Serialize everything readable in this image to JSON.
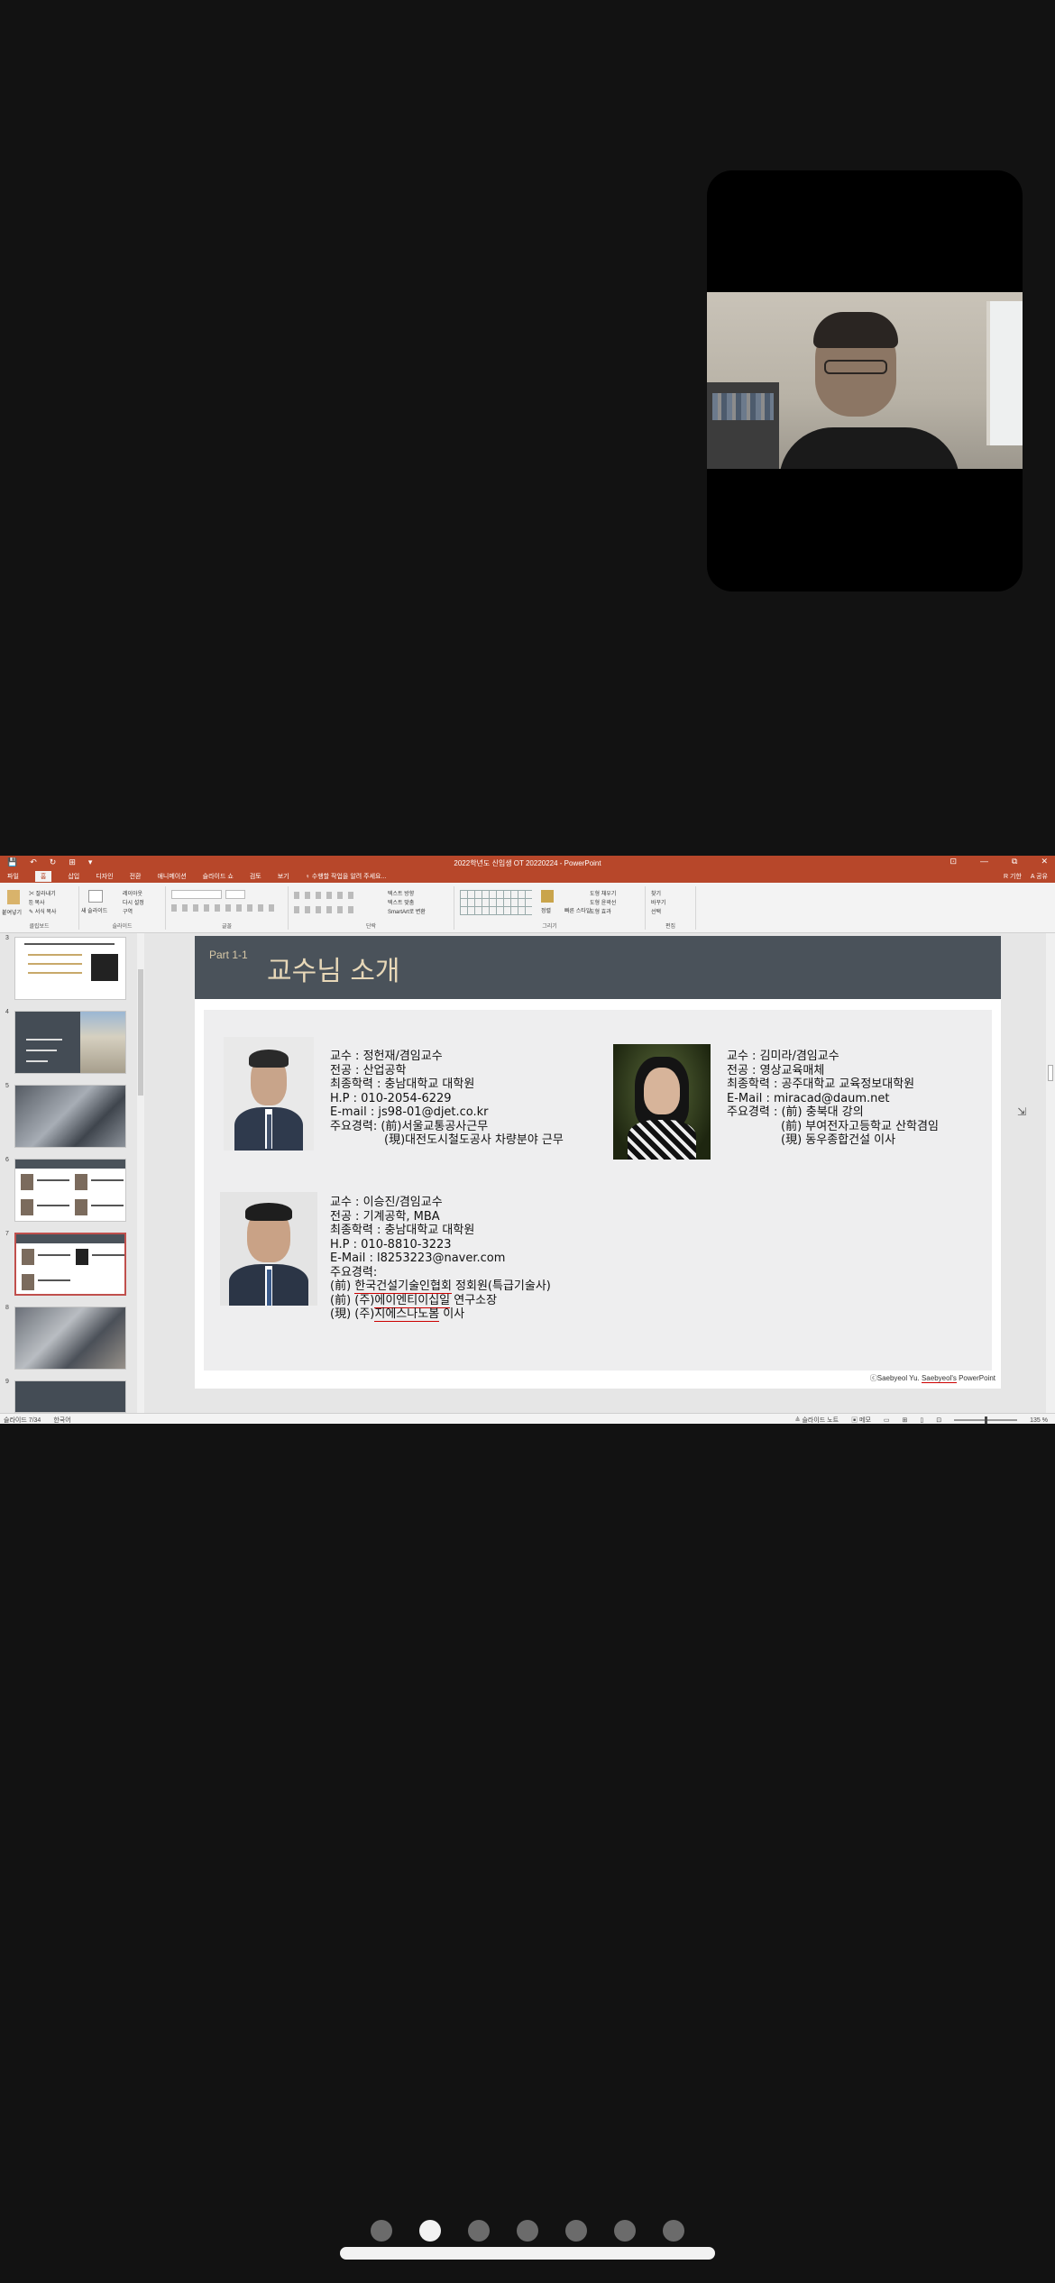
{
  "ppt": {
    "window_title": "2022학년도 신입생 OT 20220224 - PowerPoint",
    "quick_access": [
      "💾",
      "↶",
      "↻",
      "⊞",
      "▾"
    ],
    "window_controls": [
      "⊡",
      "—",
      "⧉",
      "✕"
    ],
    "tabs": [
      "파일",
      "홈",
      "삽입",
      "디자인",
      "전환",
      "애니메이션",
      "슬라이드 쇼",
      "검토",
      "보기",
      "♀ 수행할 작업을 알려 주세요..."
    ],
    "tabs_right": [
      "R 기한",
      "A 공유"
    ],
    "ribbon": {
      "paste": "붙여넣기",
      "cut": "✂ 잘라내기",
      "copy": "⎘ 복사",
      "format_painter": "✎ 서식 복사",
      "clipboard_label": "클립보드",
      "new_slide": "새 슬라이드",
      "layout": "레이아웃",
      "reset": "다시 설정",
      "section": "구역",
      "slides_label": "슬라이드",
      "font_label": "글꼴",
      "paragraph_label": "단락",
      "text_direction": "텍스트 방향",
      "align_text": "텍스트 맞춤",
      "smartart": "SmartArt로 변환",
      "arrange": "정렬",
      "quick_styles": "빠른 스타일",
      "shape_fill": "도형 채우기",
      "shape_outline": "도형 윤곽선",
      "shape_effects": "도형 효과",
      "drawing_label": "그리기",
      "find": "찾기",
      "replace": "바꾸기",
      "select": "선택",
      "editing_label": "편집"
    },
    "thumbnails": [
      "3",
      "4",
      "5",
      "6",
      "7",
      "8",
      "9"
    ],
    "slide": {
      "part": "Part 1-1",
      "title": "교수님 소개",
      "prof1": {
        "l1": "교수 : 정헌재/겸임교수",
        "l2": "전공 : 산업공학",
        "l3": "최종학력 : 충남대학교 대학원",
        "l4": "H.P : 010-2054-6229",
        "l5": "E-mail : js98-01@djet.co.kr",
        "l6": "주요경력: (前)서울교통공사근무",
        "l7": "(現)대전도시철도공사 차량분야 근무"
      },
      "prof2": {
        "l1": "교수 : 김미라/겸임교수",
        "l2": "전공 : 영상교육매체",
        "l3": "최종학력 : 공주대학교 교육정보대학원",
        "l4": "E-Mail : miracad@daum.net",
        "l5": "주요경력 : (前) 충북대 강의",
        "l6": "(前) 부여전자고등학교 산학겸임",
        "l7": "(現) 동우종합건설 이사"
      },
      "prof3": {
        "l1": "교수 : 이승진/겸임교수",
        "l2": "전공 : 기계공학, MBA",
        "l3": "최종학력 : 충남대학교 대학원",
        "l4": "H.P : 010-8810-3223",
        "l5": "E-Mail : l8253223@naver.com",
        "l6": "주요경력:",
        "l7a": "(前) ",
        "l7b": "한국건설기술인협회",
        "l7c": " 정회원(특급기술사)",
        "l8a": "(前) (주)",
        "l8b": "에이엔티이십일",
        "l8c": " 연구소장",
        "l9a": "(現) (주)",
        "l9b": "지에스나노봄",
        "l9c": " 이사"
      },
      "footer_a": "ⓒSaebyeol Yu. ",
      "footer_b": "Saebyeol's",
      "footer_c": " PowerPoint"
    },
    "status": {
      "slide_counter": "슬라이드 7/34",
      "language": "한국어",
      "notes": "≜ 슬라이드 노트",
      "comments": "▣ 메모",
      "zoom": "135 %"
    }
  },
  "pager": {
    "count": 7,
    "active_index": 1
  }
}
